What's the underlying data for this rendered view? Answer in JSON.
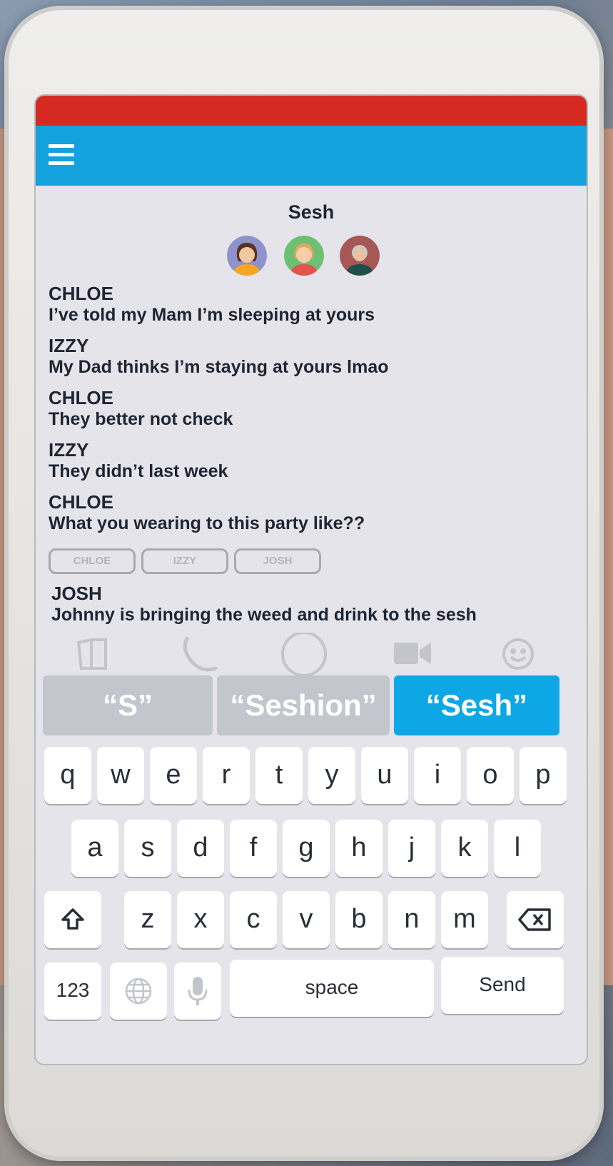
{
  "app": {
    "chat_title": "Sesh",
    "colors": {
      "status_bar": "#d42a22",
      "app_bar": "#13a2dd",
      "suggestion_active": "#0ea7e6"
    }
  },
  "header": {
    "menu_icon": "hamburger-menu-icon"
  },
  "avatars": [
    {
      "name": "avatar-chloe",
      "bg": "#8f92cc"
    },
    {
      "name": "avatar-izzy",
      "bg": "#6fbf73"
    },
    {
      "name": "avatar-josh",
      "bg": "#a65856"
    }
  ],
  "messages": [
    {
      "sender": "CHLOE",
      "text": "I’ve told my Mam I’m sleeping at yours"
    },
    {
      "sender": "IZZY",
      "text": "My Dad thinks I’m staying at yours lmao"
    },
    {
      "sender": "CHLOE",
      "text": "They better not check"
    },
    {
      "sender": "IZZY",
      "text": "They didn’t last week"
    },
    {
      "sender": "CHLOE",
      "text": "What you wearing to this party like??"
    }
  ],
  "reply_tags": [
    "CHLOE",
    "IZZY",
    "JOSH"
  ],
  "josh_message": {
    "sender": "JOSH",
    "text": "Johnny is bringing the weed and drink to the sesh"
  },
  "actions": [
    "book-icon",
    "phone-icon",
    "camera-shutter-icon",
    "video-camera-icon",
    "emoji-icon"
  ],
  "suggestions": {
    "left": "“S”",
    "middle": "“Seshion”",
    "right": "“Sesh”"
  },
  "keyboard": {
    "row1": [
      "q",
      "w",
      "e",
      "r",
      "t",
      "y",
      "u",
      "i",
      "o",
      "p"
    ],
    "row2": [
      "a",
      "s",
      "d",
      "f",
      "g",
      "h",
      "j",
      "k",
      "l"
    ],
    "row3": [
      "z",
      "x",
      "c",
      "v",
      "b",
      "n",
      "m"
    ],
    "numbers": "123",
    "space": "space",
    "send": "Send"
  }
}
